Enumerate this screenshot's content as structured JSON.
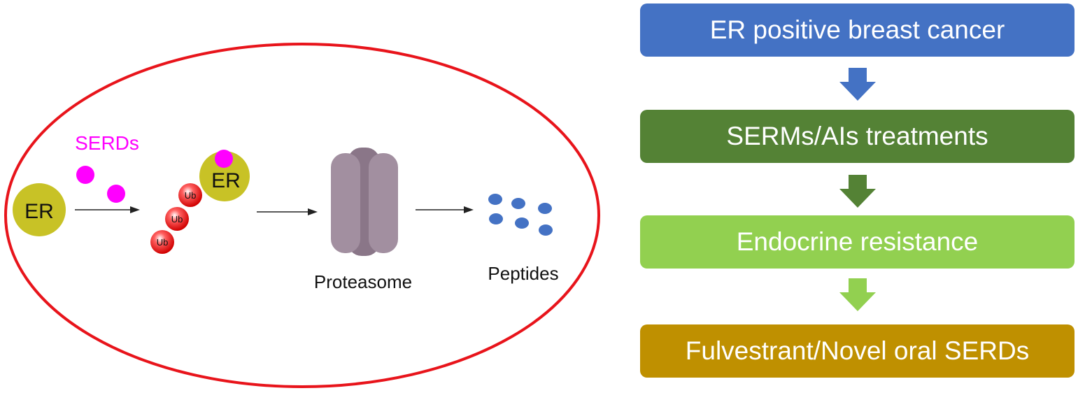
{
  "mechanism": {
    "er_label": "ER",
    "serds_label": "SERDs",
    "ub_label": "Ub",
    "proteasome_label": "Proteasome",
    "peptides_label": "Peptides"
  },
  "flowchart": {
    "steps": [
      {
        "label": "ER positive breast cancer",
        "color": "#4472c4"
      },
      {
        "label": "SERMs/AIs treatments",
        "color": "#548235"
      },
      {
        "label": "Endocrine resistance",
        "color": "#92d050"
      },
      {
        "label": "Fulvestrant/Novel oral SERDs",
        "color": "#bf9000"
      }
    ]
  },
  "colors": {
    "cell_border": "#e8141b",
    "er_ball": "#c8c226",
    "serd_molecule": "#ff00ff",
    "ubiquitin": "#e01010",
    "proteasome": "#9a8799",
    "peptide": "#4472c4"
  }
}
